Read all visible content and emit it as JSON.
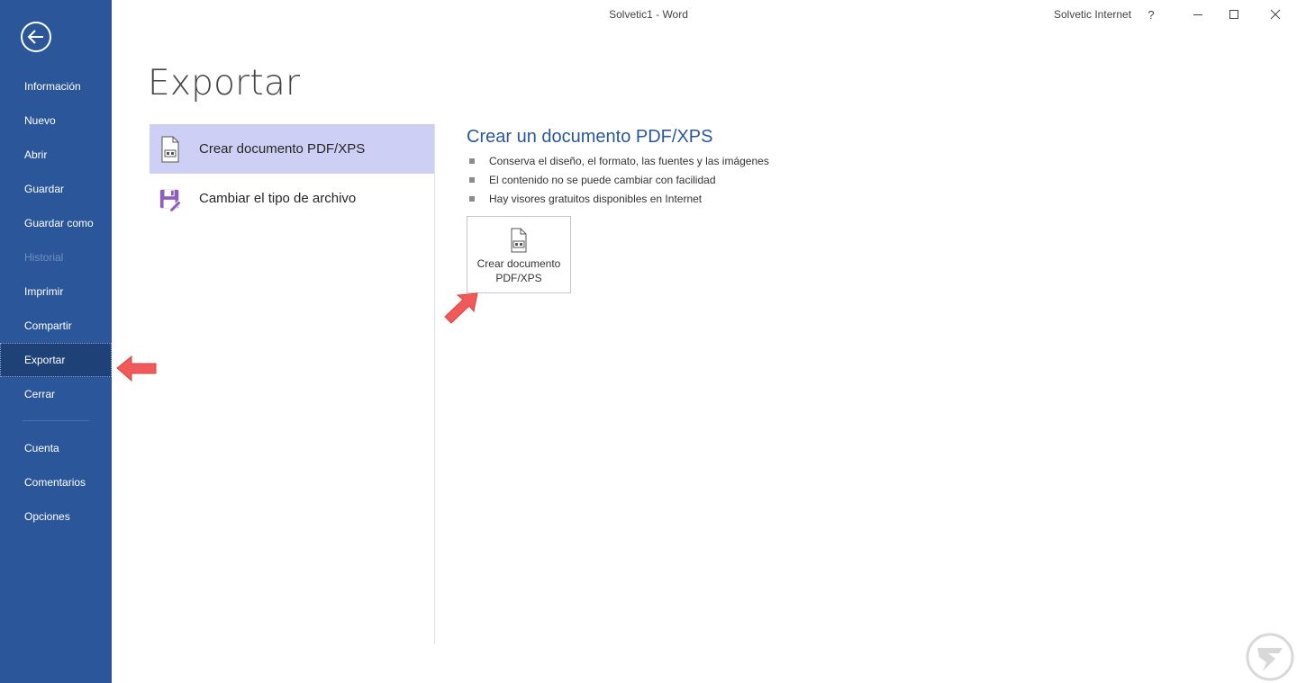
{
  "window": {
    "title": "Solvetic1  -  Word",
    "account": "Solvetic Internet",
    "help": "?"
  },
  "sidebar": {
    "items": [
      {
        "label": "Información",
        "disabled": false,
        "selected": false
      },
      {
        "label": "Nuevo",
        "disabled": false,
        "selected": false
      },
      {
        "label": "Abrir",
        "disabled": false,
        "selected": false
      },
      {
        "label": "Guardar",
        "disabled": false,
        "selected": false
      },
      {
        "label": "Guardar como",
        "disabled": false,
        "selected": false
      },
      {
        "label": "Historial",
        "disabled": true,
        "selected": false
      },
      {
        "label": "Imprimir",
        "disabled": false,
        "selected": false
      },
      {
        "label": "Compartir",
        "disabled": false,
        "selected": false
      },
      {
        "label": "Exportar",
        "disabled": false,
        "selected": true
      },
      {
        "label": "Cerrar",
        "disabled": false,
        "selected": false
      }
    ],
    "bottom_items": [
      {
        "label": "Cuenta"
      },
      {
        "label": "Comentarios"
      },
      {
        "label": "Opciones"
      }
    ]
  },
  "page": {
    "title": "Exportar"
  },
  "options": [
    {
      "label": "Crear documento PDF/XPS",
      "icon": "pdf-document-icon",
      "selected": true
    },
    {
      "label": "Cambiar el tipo de archivo",
      "icon": "save-as-icon",
      "selected": false
    }
  ],
  "detail": {
    "title": "Crear un documento PDF/XPS",
    "bullets": [
      "Conserva el diseño, el formato, las fuentes y las imágenes",
      "El contenido no se puede cambiar con facilidad",
      "Hay visores gratuitos disponibles en Internet"
    ],
    "button_label": "Crear documento PDF/XPS"
  },
  "colors": {
    "sidebar": "#2b579a",
    "sidebar_selected": "#1e4178",
    "option_selected": "#cdd0f4",
    "accent_text": "#2b579a",
    "annotation_arrow": "#f05a5a"
  }
}
